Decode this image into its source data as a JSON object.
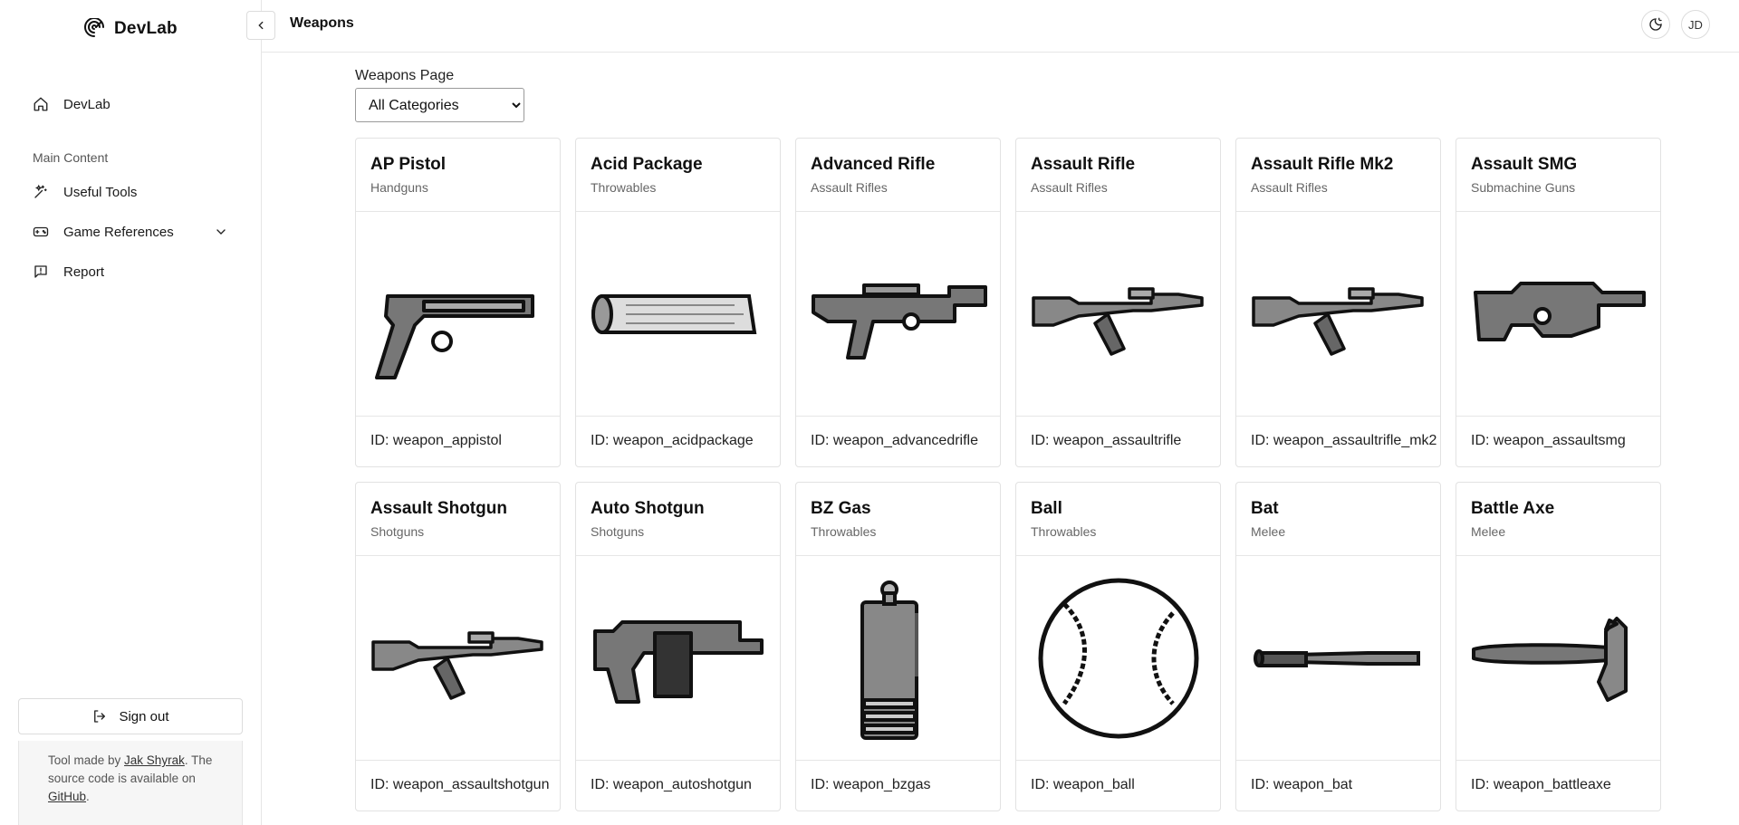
{
  "app": {
    "brand": "DevLab"
  },
  "sidebar": {
    "home_label": "DevLab",
    "section_label": "Main Content",
    "items": [
      {
        "label": "Useful Tools",
        "icon": "sparkles-icon"
      },
      {
        "label": "Game References",
        "icon": "gamepad-icon"
      },
      {
        "label": "Report",
        "icon": "message-report-icon"
      }
    ],
    "sign_out_label": "Sign out",
    "credits": {
      "prefix": "Tool made by ",
      "author": "Jak Shyrak",
      "middle": ". The source code is available on ",
      "repo": "GitHub",
      "suffix": "."
    }
  },
  "header": {
    "title": "Weapons",
    "avatar_initials": "JD"
  },
  "filter": {
    "label": "Weapons Page",
    "selected": "All Categories",
    "options": [
      "All Categories"
    ]
  },
  "weapons": [
    {
      "name": "AP Pistol",
      "category": "Handguns",
      "id_text": "ID: weapon_appistol",
      "shape": "pistol"
    },
    {
      "name": "Acid Package",
      "category": "Throwables",
      "id_text": "ID: weapon_acidpackage",
      "shape": "package"
    },
    {
      "name": "Advanced Rifle",
      "category": "Assault Rifles",
      "id_text": "ID: weapon_advancedrifle",
      "shape": "bullpup"
    },
    {
      "name": "Assault Rifle",
      "category": "Assault Rifles",
      "id_text": "ID: weapon_assaultrifle",
      "shape": "rifle"
    },
    {
      "name": "Assault Rifle Mk2",
      "category": "Assault Rifles",
      "id_text": "ID: weapon_assaultrifle_mk2",
      "shape": "rifle"
    },
    {
      "name": "Assault SMG",
      "category": "Submachine Guns",
      "id_text": "ID: weapon_assaultsmg",
      "shape": "smg"
    },
    {
      "name": "Assault Shotgun",
      "category": "Shotguns",
      "id_text": "ID: weapon_assaultshotgun",
      "shape": "rifle"
    },
    {
      "name": "Auto Shotgun",
      "category": "Shotguns",
      "id_text": "ID: weapon_autoshotgun",
      "shape": "autoshotgun"
    },
    {
      "name": "BZ Gas",
      "category": "Throwables",
      "id_text": "ID: weapon_bzgas",
      "shape": "canister"
    },
    {
      "name": "Ball",
      "category": "Throwables",
      "id_text": "ID: weapon_ball",
      "shape": "ball"
    },
    {
      "name": "Bat",
      "category": "Melee",
      "id_text": "ID: weapon_bat",
      "shape": "bat"
    },
    {
      "name": "Battle Axe",
      "category": "Melee",
      "id_text": "ID: weapon_battleaxe",
      "shape": "axe"
    }
  ]
}
